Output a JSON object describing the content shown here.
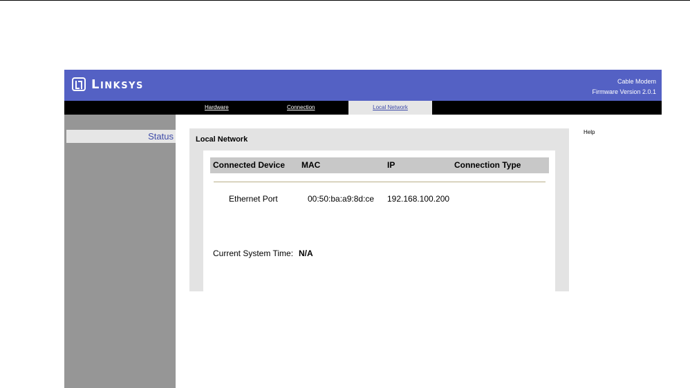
{
  "header": {
    "brand": "Linksys",
    "product": "Cable Modem",
    "firmware": "Firmware Version 2.0.1",
    "background_color": "#5461c4"
  },
  "nav": {
    "tabs": [
      {
        "label": "Hardware",
        "active": false
      },
      {
        "label": "Connection",
        "active": false
      },
      {
        "label": "Local Network",
        "active": true
      }
    ]
  },
  "sidebar": {
    "items": [
      {
        "label": "Status",
        "selected": true
      }
    ]
  },
  "help": {
    "label": "Help"
  },
  "main": {
    "title": "Local Network",
    "table": {
      "headers": [
        "Connected Device",
        "MAC",
        "IP",
        "Connection Type"
      ],
      "rows": [
        [
          "Ethernet Port",
          "00:50:ba:a9:8d:ce",
          "192.168.100.200",
          ""
        ]
      ]
    },
    "system_time": {
      "label": "Current System Time:",
      "value": "N/A"
    }
  }
}
